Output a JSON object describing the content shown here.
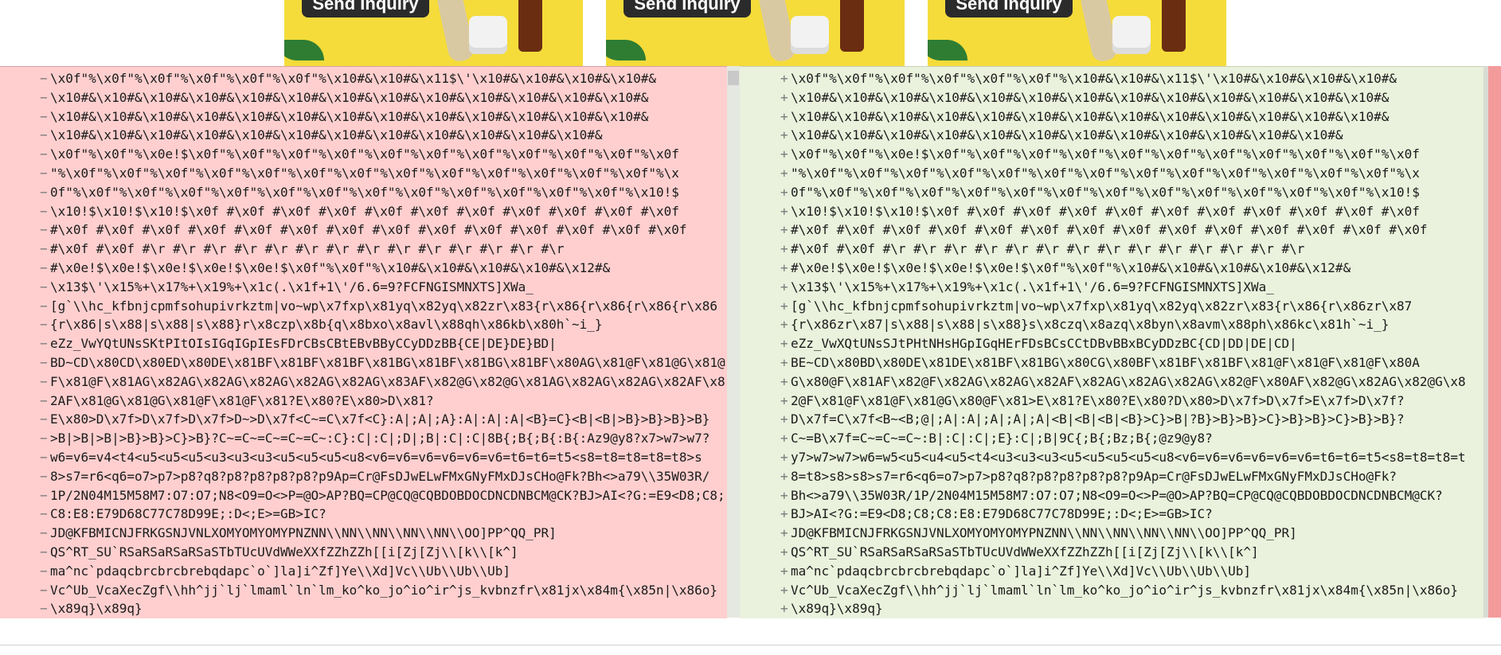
{
  "ads": [
    {
      "button_label": "Send Inquiry"
    },
    {
      "button_label": "Send Inquiry"
    },
    {
      "button_label": "Send Inquiry"
    }
  ],
  "colors": {
    "removed_bg": "#ffcfcf",
    "added_bg": "#eaf1dc"
  },
  "left_lines": [
    "\\x0f\"%\\x0f\"%\\x0f\"%\\x0f\"%\\x0f\"%\\x0f\"%\\x10#&\\x10#&\\x11$\\'\\x10#&\\x10#&\\x10#&\\x10#&",
    "\\x10#&\\x10#&\\x10#&\\x10#&\\x10#&\\x10#&\\x10#&\\x10#&\\x10#&\\x10#&\\x10#&\\x10#&\\x10#&",
    "\\x10#&\\x10#&\\x10#&\\x10#&\\x10#&\\x10#&\\x10#&\\x10#&\\x10#&\\x10#&\\x10#&\\x10#&\\x10#&",
    "\\x10#&\\x10#&\\x10#&\\x10#&\\x10#&\\x10#&\\x10#&\\x10#&\\x10#&\\x10#&\\x10#&\\x10#&",
    "\\x0f\"%\\x0f\"%\\x0e!$\\x0f\"%\\x0f\"%\\x0f\"%\\x0f\"%\\x0f\"%\\x0f\"%\\x0f\"%\\x0f\"%\\x0f\"%\\x0f\"%\\x0f",
    "\"%\\x0f\"%\\x0f\"%\\x0f\"%\\x0f\"%\\x0f\"%\\x0f\"%\\x0f\"%\\x0f\"%\\x0f\"%\\x0f\"%\\x0f\"%\\x0f\"%\\x0f\"%\\x",
    "0f\"%\\x0f\"%\\x0f\"%\\x0f\"%\\x0f\"%\\x0f\"%\\x0f\"%\\x0f\"%\\x0f\"%\\x0f\"%\\x0f\"%\\x0f\"%\\x0f\"%\\x10!$",
    "\\x10!$\\x10!$\\x10!$\\x0f #\\x0f #\\x0f #\\x0f #\\x0f #\\x0f #\\x0f #\\x0f #\\x0f #\\x0f #\\x0f",
    "#\\x0f #\\x0f #\\x0f #\\x0f #\\x0f #\\x0f #\\x0f #\\x0f #\\x0f #\\x0f #\\x0f #\\x0f #\\x0f #\\x0f",
    "#\\x0f #\\x0f #\\r #\\r #\\r #\\r #\\r #\\r #\\r #\\r #\\r #\\r #\\r #\\r #\\r #\\r",
    "#\\x0e!$\\x0e!$\\x0e!$\\x0e!$\\x0e!$\\x0f\"%\\x0f\"%\\x10#&\\x10#&\\x10#&\\x10#&\\x12#&",
    "\\x13$\\'\\x15%+\\x17%+\\x19%+\\x1c(.\\x1f+1\\'/6.6=9?FCFNGISMNXTS]XWa_",
    "[g`\\\\hc_kfbnjcpmfsohupivrkztm|vo~wp\\x7fxp\\x81yq\\x82yq\\x82zr\\x83{r\\x86{r\\x86{r\\x86{r\\x86",
    "{r\\x86|s\\x88|s\\x88|s\\x88}r\\x8czp\\x8b{q\\x8bxo\\x8avl\\x88qh\\x86kb\\x80h`~i_}",
    "eZz_VwYQtUNsSKtPItOIsIGqIGpIEsFDrCBsCBtEBvBByCCyDDzBB{CE|DE}DE}BD|",
    "BD~CD\\x80CD\\x80ED\\x80DE\\x81BF\\x81BF\\x81BF\\x81BG\\x81BF\\x81BG\\x81BF\\x80AG\\x81@F\\x81@G\\x81@",
    "F\\x81@F\\x81AG\\x82AG\\x82AG\\x82AG\\x82AG\\x82AG\\x83AF\\x82@G\\x82@G\\x81AG\\x82AG\\x82AG\\x82AF\\x8",
    "2AF\\x81@G\\x81@G\\x81@F\\x81@F\\x81?E\\x80?E\\x80>D\\x81?",
    "E\\x80>D\\x7f>D\\x7f>D\\x7f>D~>D\\x7f<C~=C\\x7f<C}:A|;A|;A}:A|:A|:A|<B}=C}<B|<B|>B}>B}>B}>B}",
    ">B|>B|>B|>B}>B}>C}>B}?C~=C~=C~=C~=C~:C}:C|:C|;D|;B|:C|:C|8B{;B{;B{:B{:Az9@y8?x7>w7>w7?",
    "w6=v6=v4<t4<u5<u5<u5<u3<u3<u3<u5<u5<u5<u8<v6=v6=v6=v6=v6=v6=t6=t6=t5<s8=t8=t8=t8=t8>s",
    "8>s7=r6<q6=o7>p7>p8?q8?p8?p8?p8?p8?p9Ap=Cr@FsDJwELwFMxGNyFMxDJsCHo@Fk?Bh<>a79\\\\35W03R/",
    "1P/2N04M15M58M7:O7:O7;N8<O9=O<>P=@O>AP?BQ=CP@CQ@CQBDOBDOCDNCDNBCM@CK?BJ>AI<?G:=E9<D8;C8;",
    "C8:E8:E79D68C77C78D99E;:D<;E>=GB>IC?",
    "JD@KFBMICNJFRKGSNJVNLXOMYOMYOMYPNZNN\\\\NN\\\\NN\\\\NN\\\\NN\\\\OO]PP^QQ_PR]",
    "QS^RT_SU`RSaRSaRSaRSaSTbTUcUVdWWeXXfZZhZZh[[i[Zj[Zj\\\\[k\\\\[k^]",
    "ma^nc`pdaqcbrcbrcbrebqdapc`o`]la]i^Zf]Ye\\\\Xd]Vc\\\\Ub\\\\Ub\\\\Ub]",
    "Vc^Ub_VcaXecZgf\\\\hh^jj`lj`lmaml`ln`lm_ko^ko_jo^io^ir^js_kvbnzfr\\x81jx\\x84m{\\x85n|\\x86o}",
    "\\x89q}\\x89q}"
  ],
  "right_lines": [
    "\\x0f\"%\\x0f\"%\\x0f\"%\\x0f\"%\\x0f\"%\\x0f\"%\\x10#&\\x10#&\\x11$\\'\\x10#&\\x10#&\\x10#&\\x10#&",
    "\\x10#&\\x10#&\\x10#&\\x10#&\\x10#&\\x10#&\\x10#&\\x10#&\\x10#&\\x10#&\\x10#&\\x10#&\\x10#&",
    "\\x10#&\\x10#&\\x10#&\\x10#&\\x10#&\\x10#&\\x10#&\\x10#&\\x10#&\\x10#&\\x10#&\\x10#&\\x10#&",
    "\\x10#&\\x10#&\\x10#&\\x10#&\\x10#&\\x10#&\\x10#&\\x10#&\\x10#&\\x10#&\\x10#&\\x10#&",
    "\\x0f\"%\\x0f\"%\\x0e!$\\x0f\"%\\x0f\"%\\x0f\"%\\x0f\"%\\x0f\"%\\x0f\"%\\x0f\"%\\x0f\"%\\x0f\"%\\x0f\"%\\x0f",
    "\"%\\x0f\"%\\x0f\"%\\x0f\"%\\x0f\"%\\x0f\"%\\x0f\"%\\x0f\"%\\x0f\"%\\x0f\"%\\x0f\"%\\x0f\"%\\x0f\"%\\x0f\"%\\x",
    "0f\"%\\x0f\"%\\x0f\"%\\x0f\"%\\x0f\"%\\x0f\"%\\x0f\"%\\x0f\"%\\x0f\"%\\x0f\"%\\x0f\"%\\x0f\"%\\x0f\"%\\x10!$",
    "\\x10!$\\x10!$\\x10!$\\x0f #\\x0f #\\x0f #\\x0f #\\x0f #\\x0f #\\x0f #\\x0f #\\x0f #\\x0f #\\x0f",
    "#\\x0f #\\x0f #\\x0f #\\x0f #\\x0f #\\x0f #\\x0f #\\x0f #\\x0f #\\x0f #\\x0f #\\x0f #\\x0f #\\x0f",
    "#\\x0f #\\x0f #\\r #\\r #\\r #\\r #\\r #\\r #\\r #\\r #\\r #\\r #\\r #\\r #\\r #\\r",
    "#\\x0e!$\\x0e!$\\x0e!$\\x0e!$\\x0e!$\\x0f\"%\\x0f\"%\\x10#&\\x10#&\\x10#&\\x10#&\\x12#&",
    "\\x13$\\'\\x15%+\\x17%+\\x19%+\\x1c(.\\x1f+1\\'/6.6=9?FCFNGISMNXTS]XWa_",
    "[g`\\\\hc_kfbnjcpmfsohupivrkztm|vo~wp\\x7fxp\\x81yq\\x82yq\\x82zr\\x83{r\\x86{r\\x86zr\\x87",
    "{r\\x86zr\\x87|s\\x88|s\\x88|s\\x88}s\\x8czq\\x8azq\\x8byn\\x8avm\\x88ph\\x86kc\\x81h`~i_}",
    "eZz_VwXQtUNsSJtPHtNHsHGpIGqHErFDsBCsCCtDBvBBxBCyDDzBC{CD|DD|DE|CD|",
    "BE~CD\\x80BD\\x80DE\\x81DE\\x81BF\\x81BG\\x80CG\\x80BF\\x81BF\\x81BF\\x81@F\\x81@F\\x81@F\\x80A",
    "G\\x80@F\\x81AF\\x82@F\\x82AG\\x82AG\\x82AF\\x82AG\\x82AG\\x82AG\\x82@F\\x80AF\\x82@G\\x82AG\\x82@G\\x8",
    "2@F\\x81@F\\x81@F\\x81@G\\x80@F\\x81>E\\x81?E\\x80?E\\x80?D\\x80>D\\x7f>D\\x7f>E\\x7f>D\\x7f?",
    "D\\x7f=C\\x7f<B~<B;@|;A|:A|;A|;A|;A|<B|<B|<B|<B}>C}>B|?B}>B}>B}>C}>B}>B}>C}>B}>B}?",
    "C~=B\\x7f=C~=C~=C~:B|:C|:C|;E}:C|;B|9C{;B{;Bz;B{;@z9@y8?",
    "y7>w7>w7>w6=w5<u5<u4<u5<t4<u3<u3<u3<u5<u5<u5<u5<u8<v6=v6=v6=v6=v6=v6=t6=t6=t5<s8=t8=t8=t",
    "8=t8>s8>s8>s7=r6<q6=o7>p7>p8?q8?p8?p8?p8?p8?p9Ap=Cr@FsDJwELwFMxGNyFMxDJsCHo@Fk?",
    "Bh<>a79\\\\35W03R/1P/2N04M15M58M7:O7:O7;N8<O9=O<>P=@O>AP?BQ=CP@CQ@CQBDOBDOCDNCDNBCM@CK?",
    "BJ>AI<?G:=E9<D8;C8;C8:E8:E79D68C77C78D99E;:D<;E>=GB>IC?",
    "JD@KFBMICNJFRKGSNJVNLXOMYOMYOMYPNZNN\\\\NN\\\\NN\\\\NN\\\\NN\\\\OO]PP^QQ_PR]",
    "QS^RT_SU`RSaRSaRSaRSaSTbTUcUVdWWeXXfZZhZZh[[i[Zj[Zj\\\\[k\\\\[k^]",
    "ma^nc`pdaqcbrcbrcbrebqdapc`o`]la]i^Zf]Ye\\\\Xd]Vc\\\\Ub\\\\Ub\\\\Ub]",
    "Vc^Ub_VcaXecZgf\\\\hh^jj`lj`lmaml`ln`lm_ko^ko_jo^io^ir^js_kvbnzfr\\x81jx\\x84m{\\x85n|\\x86o}",
    "\\x89q}\\x89q}"
  ]
}
